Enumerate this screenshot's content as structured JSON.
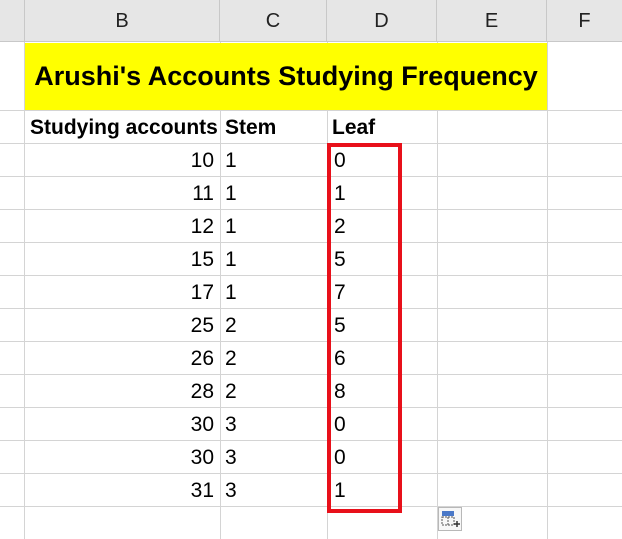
{
  "columns": [
    "B",
    "C",
    "D",
    "E",
    "F"
  ],
  "title": "Arushi's Accounts Studying Frequency",
  "headers": {
    "studying": "Studying accounts",
    "stem": "Stem",
    "leaf": "Leaf"
  },
  "rows": [
    {
      "value": "10",
      "stem": "1",
      "leaf": "0"
    },
    {
      "value": "11",
      "stem": "1",
      "leaf": "1"
    },
    {
      "value": "12",
      "stem": "1",
      "leaf": "2"
    },
    {
      "value": "15",
      "stem": "1",
      "leaf": "5"
    },
    {
      "value": "17",
      "stem": "1",
      "leaf": "7"
    },
    {
      "value": "25",
      "stem": "2",
      "leaf": "5"
    },
    {
      "value": "26",
      "stem": "2",
      "leaf": "6"
    },
    {
      "value": "28",
      "stem": "2",
      "leaf": "8"
    },
    {
      "value": "30",
      "stem": "3",
      "leaf": "0"
    },
    {
      "value": "30",
      "stem": "3",
      "leaf": "0"
    },
    {
      "value": "31",
      "stem": "3",
      "leaf": "1"
    }
  ],
  "colors": {
    "title_fill": "#ffff00",
    "highlight_border": "#e8101a",
    "header_bg": "#e6e6e6"
  },
  "icons": {
    "quick_analysis": "quick-analysis-icon"
  }
}
